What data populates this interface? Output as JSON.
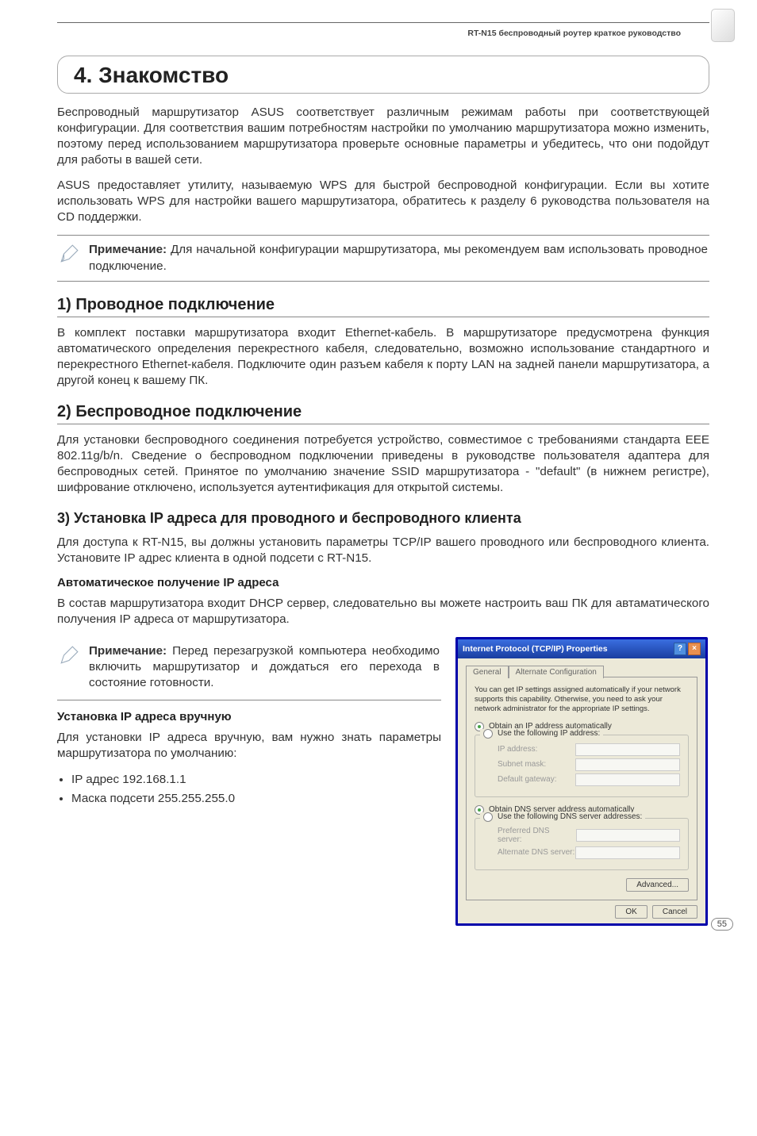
{
  "header": {
    "product_line": "RT-N15 беспроводный роутер краткое руководство"
  },
  "title": "4. Знакомство",
  "intro_p1": "Беспроводный маршрутизатор ASUS соответствует различным режимам работы при соответствующей конфигурации. Для соответствия вашим потребностям настройки по умолчанию маршрутизатора можно изменить, поэтому перед использованием маршрутизатора проверьте основные параметры и убедитесь, что они подойдут для работы в вашей сети.",
  "intro_p2": "ASUS предоставляет утилиту, называемую WPS для быстрой беспроводной конфигурации. Если вы хотите использовать WPS для настройки вашего маршрутизатора, обратитесь к разделу 6 руководства пользователя на CD поддержки.",
  "note1_label": "Примечание:",
  "note1_text": " Для начальной конфигурации маршрутизатора, мы рекомендуем вам использовать проводное подключение.",
  "sec1": {
    "title": "1) Проводное подключение",
    "p": "В комплект поставки маршрутизатора  входит Ethernet-кабель. В маршрутизаторе предусмотрена функция  автоматического определения перекрестного кабеля, следовательно, возможно использование стандартного и перекрестного Ethernet-кабеля. Подключите один разъем кабеля к порту LAN  на задней панели маршрутизатора, а другой конец к вашему ПК."
  },
  "sec2": {
    "title": "2) Беспроводное подключение",
    "p": "Для установки беспроводного соединения потребуется устройство, совместимое с требованиями стандарта ЕЕЕ 802.11g/b/n. Сведение о беспроводном подключении приведены в руководстве пользователя адаптера для беспроводных сетей. Принятое по умолчанию значение SSID маршрутизатора - \"default\" (в нижнем регистре), шифрование отключено, используется аутентификация для открытой системы."
  },
  "sec3": {
    "title": "3) Установка IP адреса для проводного и беспроводного клиента",
    "p": "Для доступа к RT-N15, вы должны установить параметры TCP/IP вашего проводного или беспроводного клиента. Установите IP адрес клиента в одной подсети с RT-N15.",
    "auto_heading": "Автоматическое получение IP адреса",
    "auto_p": "В состав маршрутизатора входит DHCP сервер, следовательно вы можете настроить ваш ПК для автаматического получения IP адреса от маршрутизатора.",
    "note2_label": "Примечание:",
    "note2_text": " Перед перезагрузкой компьютера необходимо включить маршрутизатор  и дождаться его перехода в состояние готовности.",
    "manual_heading": "Установка IP адреса вручную",
    "manual_p": "Для установки IP адреса вручную, вам нужно знать параметры маршрутизатора по умолчанию:",
    "bullet1": "IP адрес 192.168.1.1",
    "bullet2": "Маска подсети 255.255.255.0"
  },
  "dialog": {
    "title": "Internet Protocol (TCP/IP) Properties",
    "tab_general": "General",
    "tab_alt": "Alternate Configuration",
    "desc": "You can get IP settings assigned automatically if your network supports this capability. Otherwise, you need to ask your network administrator for the appropriate IP settings.",
    "r_obtain_ip": "Obtain an IP address automatically",
    "r_use_ip": "Use the following IP address:",
    "lbl_ip": "IP address:",
    "lbl_mask": "Subnet mask:",
    "lbl_gw": "Default gateway:",
    "r_obtain_dns": "Obtain DNS server address automatically",
    "r_use_dns": "Use the following DNS server addresses:",
    "lbl_pref_dns": "Preferred DNS server:",
    "lbl_alt_dns": "Alternate DNS server:",
    "btn_advanced": "Advanced...",
    "btn_ok": "OK",
    "btn_cancel": "Cancel"
  },
  "page_number": "55"
}
